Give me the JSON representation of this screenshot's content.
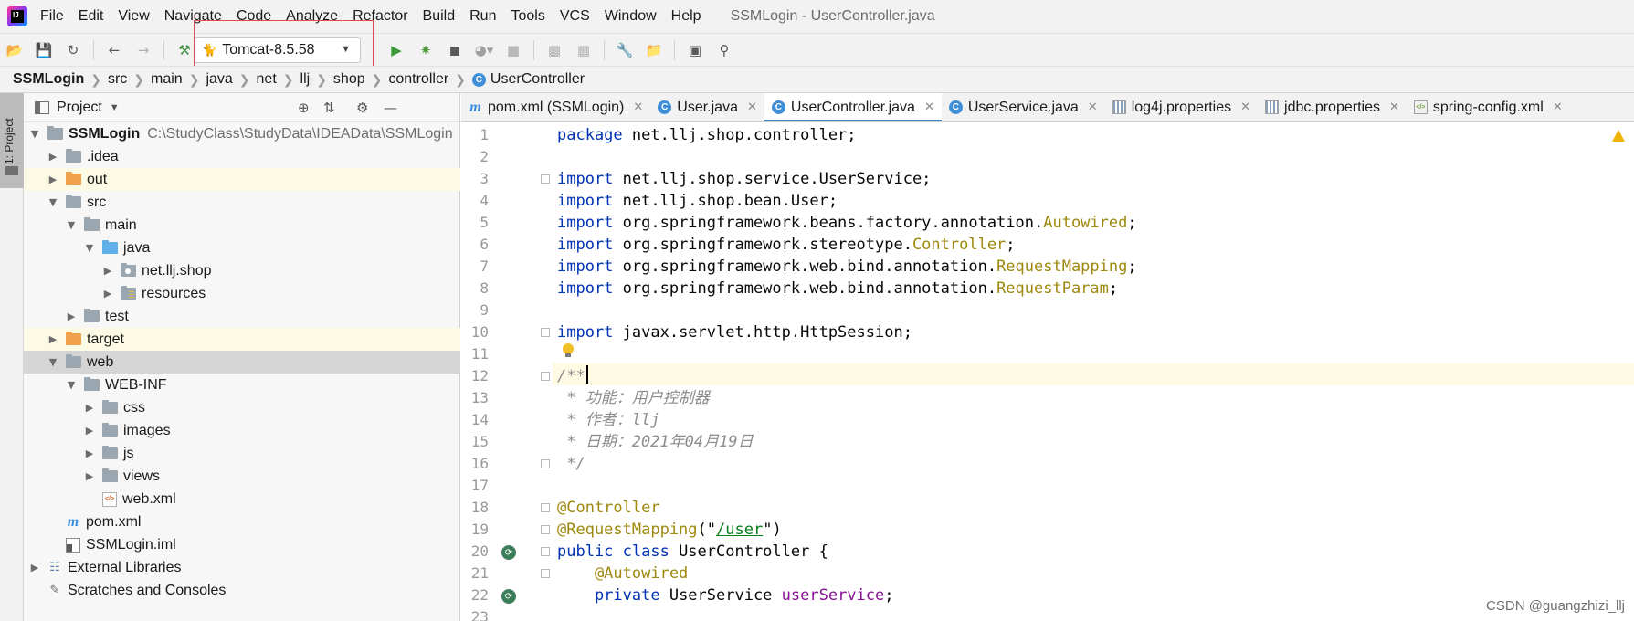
{
  "menubar": {
    "items": [
      "File",
      "Edit",
      "View",
      "Navigate",
      "Code",
      "Analyze",
      "Refactor",
      "Build",
      "Run",
      "Tools",
      "VCS",
      "Window",
      "Help"
    ],
    "window_title": "SSMLogin - UserController.java"
  },
  "toolbar": {
    "run_config": "Tomcat-8.5.58",
    "icons": [
      "open-folder-icon",
      "save-icon",
      "sync-icon",
      "back-icon",
      "forward-icon",
      "build-hammer-icon",
      "run-icon",
      "debug-icon",
      "coverage-icon",
      "profile-icon",
      "stop-icon",
      "project-structure-icon",
      "sdk-icon",
      "settings-wrench-icon",
      "module-icon",
      "terminal-icon",
      "search-icon"
    ]
  },
  "breadcrumb": [
    "SSMLogin",
    "src",
    "main",
    "java",
    "net",
    "llj",
    "shop",
    "controller",
    "UserController"
  ],
  "tool_strip": {
    "label": "1: Project"
  },
  "project_panel": {
    "title": "Project",
    "tree": [
      {
        "label": "SSMLogin",
        "path": "C:\\StudyClass\\StudyData\\IDEAData\\SSMLogin",
        "bold": true
      },
      {
        "label": ".idea"
      },
      {
        "label": "out"
      },
      {
        "label": "src"
      },
      {
        "label": "main"
      },
      {
        "label": "java"
      },
      {
        "label": "net.llj.shop"
      },
      {
        "label": "resources"
      },
      {
        "label": "test"
      },
      {
        "label": "target"
      },
      {
        "label": "web"
      },
      {
        "label": "WEB-INF"
      },
      {
        "label": "css"
      },
      {
        "label": "images"
      },
      {
        "label": "js"
      },
      {
        "label": "views"
      },
      {
        "label": "web.xml"
      },
      {
        "label": "pom.xml"
      },
      {
        "label": "SSMLogin.iml"
      },
      {
        "label": "External Libraries"
      },
      {
        "label": "Scratches and Consoles"
      }
    ]
  },
  "editor_tabs": [
    {
      "label": "pom.xml (SSMLogin)",
      "icon": "maven-icon"
    },
    {
      "label": "User.java",
      "icon": "class-icon"
    },
    {
      "label": "UserController.java",
      "icon": "class-icon",
      "active": true
    },
    {
      "label": "UserService.java",
      "icon": "class-icon"
    },
    {
      "label": "log4j.properties",
      "icon": "properties-icon"
    },
    {
      "label": "jdbc.properties",
      "icon": "properties-icon"
    },
    {
      "label": "spring-config.xml",
      "icon": "xml-icon"
    }
  ],
  "editor": {
    "line_numbers": [
      "1",
      "2",
      "3",
      "4",
      "5",
      "6",
      "7",
      "8",
      "9",
      "10",
      "11",
      "12",
      "13",
      "14",
      "15",
      "16",
      "17",
      "18",
      "19",
      "20",
      "21",
      "22",
      "23"
    ],
    "code": {
      "l1_kw": "package",
      "l1_rest": " net.llj.shop.controller;",
      "kw_import": "import",
      "l3": " net.llj.shop.service.UserService;",
      "l4": " net.llj.shop.bean.User;",
      "l5_a": " org.springframework.beans.factory.annotation.",
      "l5_b": "Autowired",
      "l5_c": ";",
      "l6_a": " org.springframework.stereotype.",
      "l6_b": "Controller",
      "l6_c": ";",
      "l7_a": " org.springframework.web.bind.annotation.",
      "l7_b": "RequestMapping",
      "l7_c": ";",
      "l8_a": " org.springframework.web.bind.annotation.",
      "l8_b": "RequestParam",
      "l8_c": ";",
      "l10": " javax.servlet.http.HttpSession;",
      "l12": "/**",
      "l13": " * 功能：用户控制器",
      "l14": " * 作者：llj",
      "l15": " * 日期：2021年04月19日",
      "l16": " */",
      "l18": "@Controller",
      "l19_a": "@RequestMapping",
      "l19_b": "(\"",
      "l19_c": "/user",
      "l19_d": "\")",
      "l20_a": "public class",
      "l20_b": " UserController {",
      "l21": "    @Autowired",
      "l22_a": "    private",
      "l22_b": " UserService ",
      "l22_c": "userService",
      "l22_d": ";"
    }
  },
  "watermark": "CSDN @guangzhizi_llj"
}
